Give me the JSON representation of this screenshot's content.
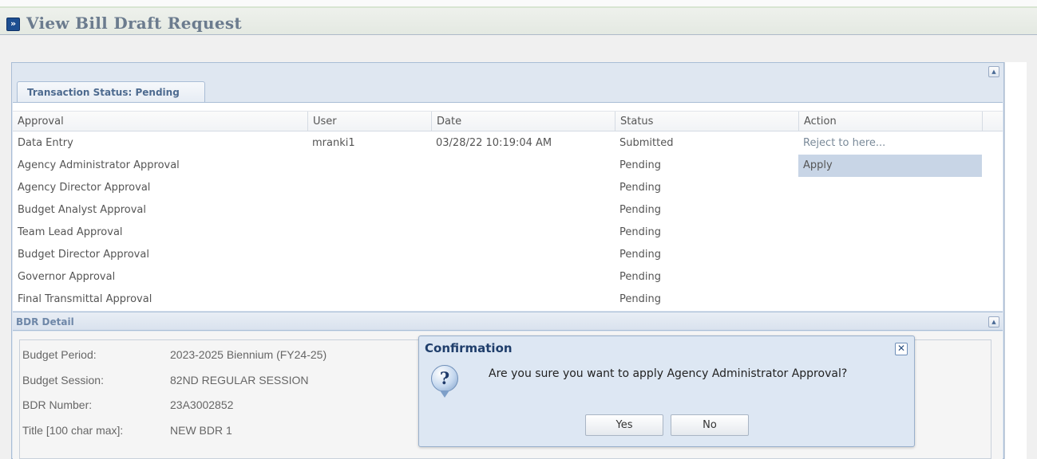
{
  "page": {
    "title": "View Bill Draft Request",
    "expand_icon": "double-chevron-right-icon"
  },
  "tab": {
    "label": "Transaction Status: Pending"
  },
  "approval_table": {
    "columns": [
      "Approval",
      "User",
      "Date",
      "Status",
      "Action"
    ],
    "rows": [
      {
        "approval": "Data Entry",
        "user": "mranki1",
        "date": "03/28/22 10:19:04 AM",
        "status": "Submitted",
        "action": "Reject to here..."
      },
      {
        "approval": "Agency Administrator Approval",
        "user": "",
        "date": "",
        "status": "Pending",
        "action": "Apply"
      },
      {
        "approval": "Agency Director Approval",
        "user": "",
        "date": "",
        "status": "Pending",
        "action": ""
      },
      {
        "approval": "Budget Analyst Approval",
        "user": "",
        "date": "",
        "status": "Pending",
        "action": ""
      },
      {
        "approval": "Team Lead Approval",
        "user": "",
        "date": "",
        "status": "Pending",
        "action": ""
      },
      {
        "approval": "Budget Director Approval",
        "user": "",
        "date": "",
        "status": "Pending",
        "action": ""
      },
      {
        "approval": "Governor Approval",
        "user": "",
        "date": "",
        "status": "Pending",
        "action": ""
      },
      {
        "approval": "Final Transmittal Approval",
        "user": "",
        "date": "",
        "status": "Pending",
        "action": ""
      }
    ]
  },
  "bdr_detail": {
    "header": "BDR Detail",
    "fields": [
      {
        "label": "Budget Period:",
        "value": "2023-2025 Biennium (FY24-25)"
      },
      {
        "label": "Budget Session:",
        "value": "82ND REGULAR SESSION"
      },
      {
        "label": "BDR Number:",
        "value": "23A3002852"
      },
      {
        "label": "Title [100 char max]:",
        "value": "NEW BDR 1"
      }
    ]
  },
  "dialog": {
    "title": "Confirmation",
    "message": "Are you sure you want to apply Agency Administrator Approval?",
    "yes_label": "Yes",
    "no_label": "No",
    "question_glyph": "?",
    "close_glyph": "✕"
  },
  "colors": {
    "title_text": "#6b7b8e",
    "panel_border": "#a9bdd6",
    "selected_cell": "#c8d5e6",
    "dialog_bg": "#dde7f3",
    "dialog_title": "#1f3e6b"
  }
}
